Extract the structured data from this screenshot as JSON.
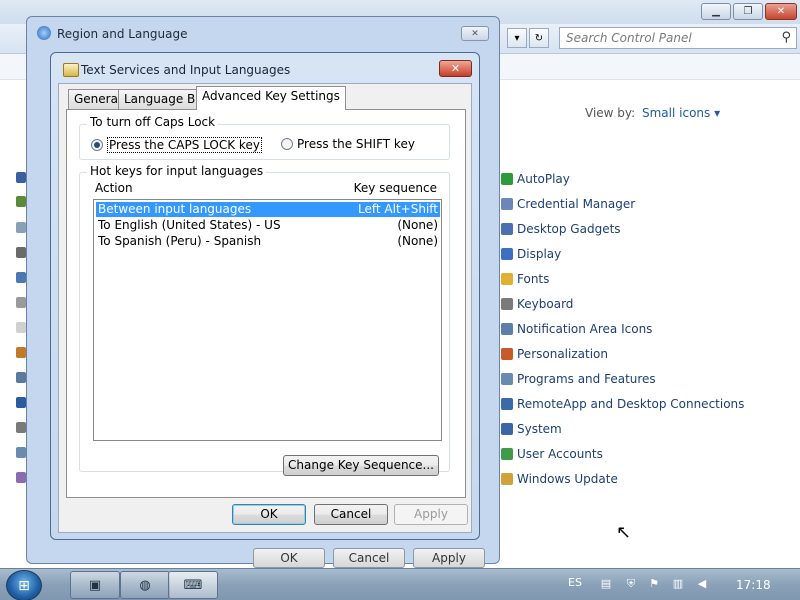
{
  "control_panel": {
    "search_placeholder": "Search Control Panel",
    "view_by_label": "View by:",
    "view_by_value": "Small icons",
    "items": [
      {
        "label": "AutoPlay",
        "color": "#2e9b3b"
      },
      {
        "label": "Credential Manager",
        "color": "#6a87b8"
      },
      {
        "label": "Desktop Gadgets",
        "color": "#4a70b0"
      },
      {
        "label": "Display",
        "color": "#3d70c0"
      },
      {
        "label": "Fonts",
        "color": "#e0b030"
      },
      {
        "label": "Keyboard",
        "color": "#7a7a7a"
      },
      {
        "label": "Notification Area Icons",
        "color": "#5c7fa8"
      },
      {
        "label": "Personalization",
        "color": "#c85a2a"
      },
      {
        "label": "Programs and Features",
        "color": "#6a8ab0"
      },
      {
        "label": "RemoteApp and Desktop Connections",
        "color": "#3b6aa8"
      },
      {
        "label": "System",
        "color": "#3a66a8"
      },
      {
        "label": "User Accounts",
        "color": "#3f9a4a"
      },
      {
        "label": "Windows Update",
        "color": "#d2a23a"
      }
    ]
  },
  "region_window": {
    "title": "Region and Language",
    "ok_label": "OK",
    "cancel_label": "Cancel",
    "apply_label": "Apply"
  },
  "dialog": {
    "title": "Text Services and Input Languages",
    "tabs": [
      {
        "label": "General"
      },
      {
        "label": "Language Bar"
      },
      {
        "label": "Advanced Key Settings"
      }
    ],
    "caps_group_label": "To turn off Caps Lock",
    "radio_caps": "Press the CAPS LOCK key",
    "radio_shift": "Press the SHIFT key",
    "hotkeys_group_label": "Hot keys for input languages",
    "col_action": "Action",
    "col_key": "Key sequence",
    "rows": [
      {
        "action": "Between input languages",
        "key": "Left Alt+Shift"
      },
      {
        "action": "To English (United States) - US",
        "key": "(None)"
      },
      {
        "action": "To Spanish (Peru) - Spanish",
        "key": "(None)"
      }
    ],
    "change_key_label": "Change Key Sequence...",
    "ok_label": "OK",
    "cancel_label": "Cancel",
    "apply_label": "Apply"
  },
  "taskbar": {
    "language": "ES",
    "time": "17:18"
  }
}
